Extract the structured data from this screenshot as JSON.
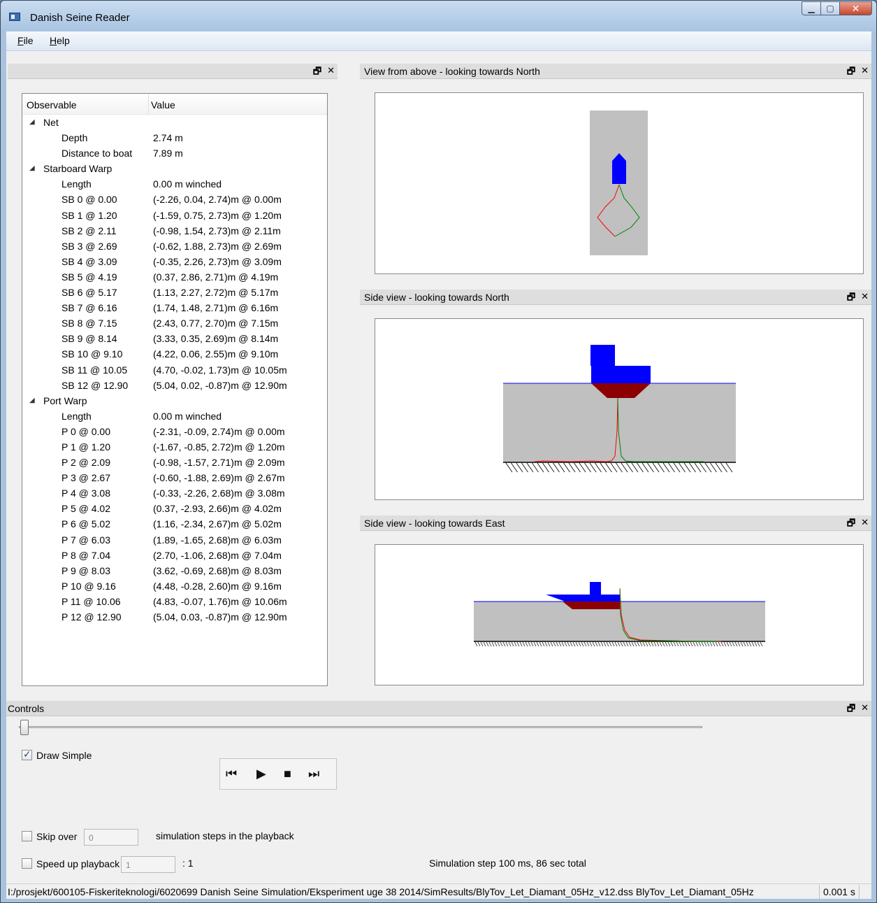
{
  "window": {
    "title": "Danish Seine Reader",
    "min_label": "▁",
    "max_label": "▢",
    "close_label": "✕"
  },
  "menu": [
    {
      "key": "F",
      "rest": "ile"
    },
    {
      "key": "H",
      "rest": "elp"
    }
  ],
  "dock_buttons": {
    "float": "🗗",
    "close": "✕"
  },
  "tree": {
    "headers": [
      "Observable",
      "Value"
    ],
    "net": {
      "label": "Net",
      "depth_label": "Depth",
      "depth": "2.74 m",
      "dist_label": "Distance to boat",
      "dist": "7.89 m"
    },
    "starboard": {
      "label": "Starboard Warp",
      "length_label": "Length",
      "length": "0.00 m winched",
      "points": [
        {
          "k": "SB  0 @ 0.00",
          "v": "(-2.26, 0.04, 2.74)m @ 0.00m"
        },
        {
          "k": "SB  1 @ 1.20",
          "v": "(-1.59, 0.75, 2.73)m @ 1.20m"
        },
        {
          "k": "SB  2 @ 2.11",
          "v": "(-0.98, 1.54, 2.73)m @ 2.11m"
        },
        {
          "k": "SB  3 @ 2.69",
          "v": "(-0.62, 1.88, 2.73)m @ 2.69m"
        },
        {
          "k": "SB  4 @ 3.09",
          "v": "(-0.35, 2.26, 2.73)m @ 3.09m"
        },
        {
          "k": "SB  5 @ 4.19",
          "v": "(0.37, 2.86, 2.71)m @ 4.19m"
        },
        {
          "k": "SB  6 @ 5.17",
          "v": "(1.13, 2.27, 2.72)m @ 5.17m"
        },
        {
          "k": "SB  7 @ 6.16",
          "v": "(1.74, 1.48, 2.71)m @ 6.16m"
        },
        {
          "k": "SB  8 @ 7.15",
          "v": "(2.43, 0.77, 2.70)m @ 7.15m"
        },
        {
          "k": "SB  9 @ 8.14",
          "v": "(3.33, 0.35, 2.69)m @ 8.14m"
        },
        {
          "k": "SB  10 @ 9.10",
          "v": "(4.22, 0.06, 2.55)m @ 9.10m"
        },
        {
          "k": "SB  11 @ 10.05",
          "v": "(4.70, -0.02, 1.73)m @ 10.05m"
        },
        {
          "k": "SB  12 @ 12.90",
          "v": "(5.04, 0.02, -0.87)m @ 12.90m"
        }
      ]
    },
    "port": {
      "label": "Port Warp",
      "length_label": "Length",
      "length": "0.00 m winched",
      "points": [
        {
          "k": "P  0 @ 0.00",
          "v": "(-2.31, -0.09, 2.74)m @ 0.00m"
        },
        {
          "k": "P  1 @ 1.20",
          "v": "(-1.67, -0.85, 2.72)m @ 1.20m"
        },
        {
          "k": "P  2 @ 2.09",
          "v": "(-0.98, -1.57, 2.71)m @ 2.09m"
        },
        {
          "k": "P  3 @ 2.67",
          "v": "(-0.60, -1.88, 2.69)m @ 2.67m"
        },
        {
          "k": "P  4 @ 3.08",
          "v": "(-0.33, -2.26, 2.68)m @ 3.08m"
        },
        {
          "k": "P  5 @ 4.02",
          "v": "(0.37, -2.93, 2.66)m @ 4.02m"
        },
        {
          "k": "P  6 @ 5.02",
          "v": "(1.16, -2.34, 2.67)m @ 5.02m"
        },
        {
          "k": "P  7 @ 6.03",
          "v": "(1.89, -1.65, 2.68)m @ 6.03m"
        },
        {
          "k": "P  8 @ 7.04",
          "v": "(2.70, -1.06, 2.68)m @ 7.04m"
        },
        {
          "k": "P  9 @ 8.03",
          "v": "(3.62, -0.69, 2.68)m @ 8.03m"
        },
        {
          "k": "P  10 @ 9.16",
          "v": "(4.48, -0.28, 2.60)m @ 9.16m"
        },
        {
          "k": "P  11 @ 10.06",
          "v": "(4.83, -0.07, 1.76)m @ 10.06m"
        },
        {
          "k": "P  12 @ 12.90",
          "v": "(5.04, 0.03, -0.87)m @ 12.90m"
        }
      ]
    }
  },
  "views": {
    "top": "View from above - looking towards North",
    "north": "Side view - looking towards North",
    "east": "Side view - looking towards East"
  },
  "colors": {
    "boat": "#0000ff",
    "hull": "#8b0000",
    "water": "#c0c0c0",
    "starboard": "#008000",
    "port": "#ff0000",
    "surface": "#0000ff"
  },
  "controls": {
    "title": "Controls",
    "draw_simple": "Draw Simple",
    "draw_simple_checked": true,
    "skip_label": "Skip over",
    "skip_value": "0",
    "skip_suffix": "simulation steps in the playback",
    "speed_label": "Speed up playback",
    "speed_value": "1",
    "speed_suffix": ": 1",
    "sim_info": "Simulation step 100 ms, 86 sec total",
    "player": {
      "first": "⏮",
      "play": "▶",
      "stop": "■",
      "last": "⏭"
    }
  },
  "status": {
    "path": "I:/prosjekt/600105-Fiskeriteknologi/6020699 Danish Seine Simulation/Eksperiment uge 38 2014/SimResults/BlyTov_Let_Diamant_05Hz_v12.dss BlyTov_Let_Diamant_05Hz",
    "time": "0.001 s"
  }
}
